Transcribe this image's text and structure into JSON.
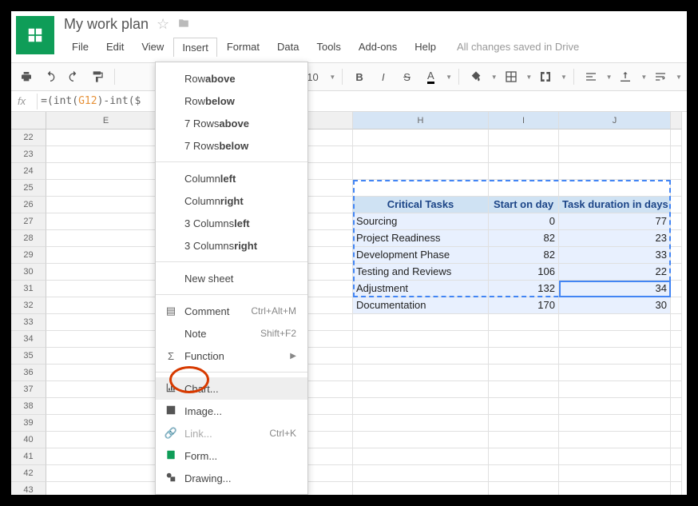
{
  "doc": {
    "title": "My work plan"
  },
  "menubar": {
    "file": "File",
    "edit": "Edit",
    "view": "View",
    "insert": "Insert",
    "format": "Format",
    "data": "Data",
    "tools": "Tools",
    "addons": "Add-ons",
    "help": "Help",
    "status": "All changes saved in Drive"
  },
  "toolbar": {
    "font_size": "10"
  },
  "formula": {
    "fx": "fx",
    "prefix": "=(int(",
    "ref": "G12",
    "suffix": ")-int($"
  },
  "cols": {
    "E": "E",
    "H": "H",
    "I": "I",
    "J": "J"
  },
  "rows": [
    "22",
    "23",
    "24",
    "25",
    "26",
    "27",
    "28",
    "29",
    "30",
    "31",
    "32",
    "33",
    "34",
    "35",
    "36",
    "37",
    "38",
    "39",
    "40",
    "41",
    "42",
    "43"
  ],
  "table": {
    "headers": {
      "h": "Critical Tasks",
      "i": "Start on day",
      "j": "Task duration in days"
    },
    "data": [
      {
        "h": "Sourcing",
        "i": "0",
        "j": "77"
      },
      {
        "h": "Project Readiness",
        "i": "82",
        "j": "23"
      },
      {
        "h": "Development Phase",
        "i": "82",
        "j": "33"
      },
      {
        "h": "Testing and Reviews",
        "i": "106",
        "j": "22"
      },
      {
        "h": "Adjustment",
        "i": "132",
        "j": "34"
      },
      {
        "h": "Documentation",
        "i": "170",
        "j": "30"
      }
    ]
  },
  "menu": {
    "row_above_a": "Row ",
    "row_above_b": "above",
    "row_below_a": "Row ",
    "row_below_b": "below",
    "rows7_above_a": "7 Rows ",
    "rows7_above_b": "above",
    "rows7_below_a": "7 Rows ",
    "rows7_below_b": "below",
    "col_left_a": "Column ",
    "col_left_b": "left",
    "col_right_a": "Column ",
    "col_right_b": "right",
    "cols3_left_a": "3 Columns ",
    "cols3_left_b": "left",
    "cols3_right_a": "3 Columns ",
    "cols3_right_b": "right",
    "new_sheet": "New sheet",
    "comment": "Comment",
    "comment_sc": "Ctrl+Alt+M",
    "note": "Note",
    "note_sc": "Shift+F2",
    "function": "Function",
    "chart": "Chart...",
    "image": "Image...",
    "link": "Link...",
    "link_sc": "Ctrl+K",
    "form": "Form...",
    "drawing": "Drawing..."
  }
}
